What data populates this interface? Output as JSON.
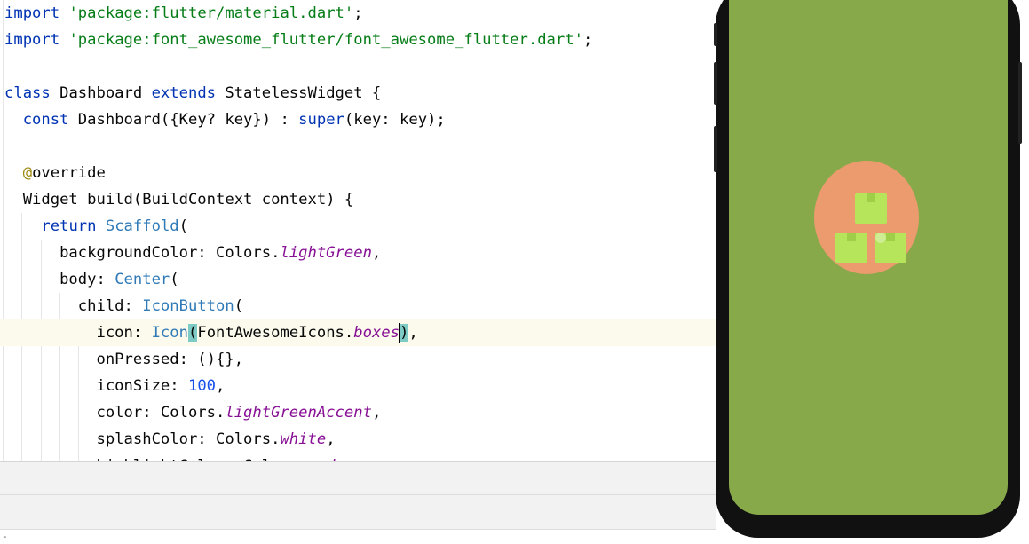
{
  "editor": {
    "lines": [
      [
        {
          "t": "import",
          "c": "kw"
        },
        {
          "t": " "
        },
        {
          "t": "'package:flutter/material.dart'",
          "c": "str"
        },
        {
          "t": ";"
        }
      ],
      [
        {
          "t": "import",
          "c": "kw"
        },
        {
          "t": " "
        },
        {
          "t": "'package:font_awesome_flutter/font_awesome_flutter.dart'",
          "c": "str"
        },
        {
          "t": ";"
        }
      ],
      [],
      [
        {
          "t": "class",
          "c": "kw"
        },
        {
          "t": " Dashboard "
        },
        {
          "t": "extends",
          "c": "kw"
        },
        {
          "t": " StatelessWidget {"
        }
      ],
      [
        {
          "t": "  "
        },
        {
          "t": "const",
          "c": "kw"
        },
        {
          "t": " Dashboard({Key? key}) : "
        },
        {
          "t": "super",
          "c": "kw"
        },
        {
          "t": "(key: key);"
        }
      ],
      [],
      [
        {
          "t": "  "
        },
        {
          "t": "@",
          "c": "ann"
        },
        {
          "t": "override"
        }
      ],
      [
        {
          "t": "  Widget build(BuildContext context) {"
        }
      ],
      [
        {
          "t": "    "
        },
        {
          "t": "return",
          "c": "kw"
        },
        {
          "t": " "
        },
        {
          "t": "Scaffold",
          "c": "widget"
        },
        {
          "t": "("
        }
      ],
      [
        {
          "t": "      backgroundColor: Colors."
        },
        {
          "t": "lightGreen",
          "c": "field"
        },
        {
          "t": ","
        }
      ],
      [
        {
          "t": "      body: "
        },
        {
          "t": "Center",
          "c": "widget"
        },
        {
          "t": "("
        }
      ],
      [
        {
          "t": "        child: "
        },
        {
          "t": "IconButton",
          "c": "widget"
        },
        {
          "t": "("
        }
      ],
      [
        {
          "t": "          icon: "
        },
        {
          "t": "Icon",
          "c": "widget"
        },
        {
          "t": "(",
          "c": "hl"
        },
        {
          "t": "FontAwesomeIcons."
        },
        {
          "t": "boxes",
          "c": "field"
        },
        {
          "t": "CARET"
        },
        {
          "t": ")",
          "c": "hl"
        },
        {
          "t": ","
        }
      ],
      [
        {
          "t": "          onPressed: (){},"
        }
      ],
      [
        {
          "t": "          iconSize: "
        },
        {
          "t": "100",
          "c": "num"
        },
        {
          "t": ","
        }
      ],
      [
        {
          "t": "          color: Colors."
        },
        {
          "t": "lightGreenAccent",
          "c": "field"
        },
        {
          "t": ","
        }
      ],
      [
        {
          "t": "          splashColor: Colors."
        },
        {
          "t": "white",
          "c": "field"
        },
        {
          "t": ","
        }
      ],
      [
        {
          "t": "          highlightColor: Colors."
        },
        {
          "t": "red",
          "c": "field"
        },
        {
          "t": ","
        }
      ]
    ],
    "current_line": 12
  },
  "bottom_pane": {
    "status_text": "-"
  },
  "device": {
    "screen_color": "#88a94a",
    "splash_color": "#ec9b6f",
    "icon_color": "#b6e45a",
    "icon_name": "boxes-icon"
  }
}
